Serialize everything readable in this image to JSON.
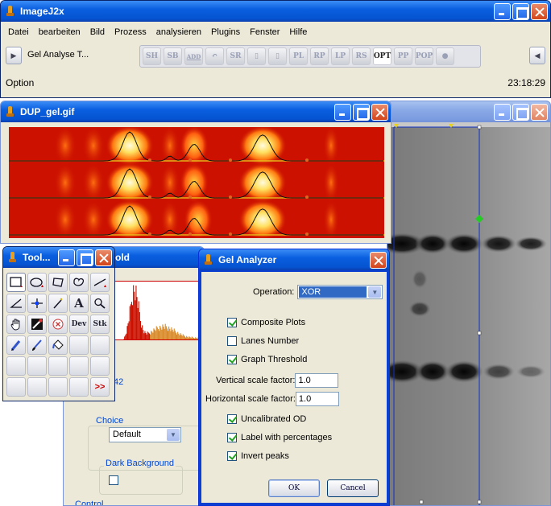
{
  "main": {
    "title": "ImageJ2x",
    "menu": [
      "Datei",
      "bearbeiten",
      "Bild",
      "Prozess",
      "analysieren",
      "Plugins",
      "Fenster",
      "Hilfe"
    ],
    "toolbar_label": "Gel Analyse T...",
    "tool_buttons": [
      "SH",
      "SB",
      "ADD",
      "UNDO",
      "SR",
      "C1",
      "C2",
      "PL",
      "RP",
      "LP",
      "RS",
      "OPT",
      "PP",
      "POP",
      "INFO"
    ],
    "active_tool": "OPT",
    "status_left": "Option",
    "status_time": "23:18:29"
  },
  "gel_window": {
    "title": "DUP_gel.gif",
    "lanes": 3
  },
  "hist_window": {
    "title_fragment": "old",
    "value_fragment": "42",
    "choice_label": "Choice",
    "choice_value": "Default",
    "dark_bg_label": "Dark Background",
    "control_label": "Control"
  },
  "tools_window": {
    "title": "Tool...",
    "cells": [
      "rect",
      "oval",
      "polygon",
      "freehand",
      "line",
      "angle",
      "point",
      "wand",
      "A",
      "magnifier",
      "hand",
      "dropper",
      "x",
      "Dev",
      "Stk",
      "pencil",
      "brush",
      "fill",
      "",
      "",
      "",
      "",
      "",
      "",
      "",
      "",
      "",
      "",
      "",
      ">>"
    ],
    "dev_label": "Dev",
    "stk_label": "Stk",
    "text_label": "A",
    "more_label": ">>"
  },
  "dialog": {
    "title": "Gel Analyzer",
    "operation_label": "Operation:",
    "operation_value": "XOR",
    "composite_plots": "Composite Plots",
    "lanes_number": "Lanes Number",
    "graph_threshold": "Graph Threshold",
    "vertical_label": "Vertical scale factor:",
    "vertical_value": "1.0",
    "horizontal_label": "Horizontal scale factor:",
    "horizontal_value": "1.0",
    "uncalibrated": "Uncalibrated OD",
    "label_percent": "Label with percentages",
    "invert_peaks": "Invert peaks",
    "ok": "OK",
    "cancel": "Cancel"
  },
  "colors": {
    "titlebar": "#0553d0",
    "dialog_bg": "#ece9d8",
    "heat_hot": "#fff7b0",
    "heat_cold": "#cc1100"
  }
}
